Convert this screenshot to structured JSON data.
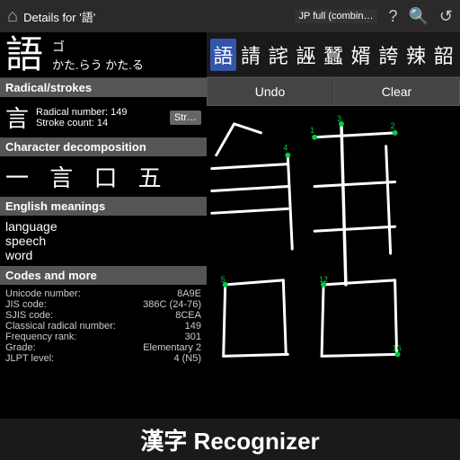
{
  "topbar": {
    "home_icon": "⌂",
    "title": "Details for '語'",
    "mode": "JP full (combin…",
    "icon_help": "?",
    "icon_search": "🔍",
    "icon_refresh": "↺"
  },
  "kanji": {
    "character": "語",
    "reading_on": "ゴ",
    "reading_kun": "かた.らう かた.る"
  },
  "sections": {
    "radical_strokes_label": "Radical/strokes",
    "radical_icon": "言",
    "radical_number_label": "Radical number:",
    "radical_number": "149",
    "stroke_count_label": "Stroke count:",
    "stroke_count": "14",
    "stroke_btn": "Str…",
    "decomposition_label": "Character decomposition",
    "decomp_chars": "一 言 口 五",
    "meanings_label": "English meanings",
    "meanings": [
      "language",
      "speech",
      "word"
    ],
    "codes_label": "Codes and more",
    "codes": [
      {
        "label": "Unicode number:",
        "value": "8A9E"
      },
      {
        "label": "JIS code:",
        "value": "386C (24-76)"
      },
      {
        "label": "SJIS code:",
        "value": "8CEA"
      },
      {
        "label": "Classical radical number:",
        "value": "149"
      },
      {
        "label": "Frequency rank:",
        "value": "301"
      },
      {
        "label": "Grade:",
        "value": "Elementary 2"
      },
      {
        "label": "JLPT level:",
        "value": "4 (N5)"
      }
    ]
  },
  "similar_kanji": [
    {
      "char": "語",
      "active": true
    },
    {
      "char": "請",
      "active": false
    },
    {
      "char": "詫",
      "active": false
    },
    {
      "char": "誣",
      "active": false
    },
    {
      "char": "蠶",
      "active": false
    },
    {
      "char": "婿",
      "active": false
    },
    {
      "char": "誇",
      "active": false
    },
    {
      "char": "辣",
      "active": false
    },
    {
      "char": "韶",
      "active": false
    }
  ],
  "buttons": {
    "undo": "Undo",
    "clear": "Clear"
  },
  "bottom_title": "漢字 Recognizer"
}
